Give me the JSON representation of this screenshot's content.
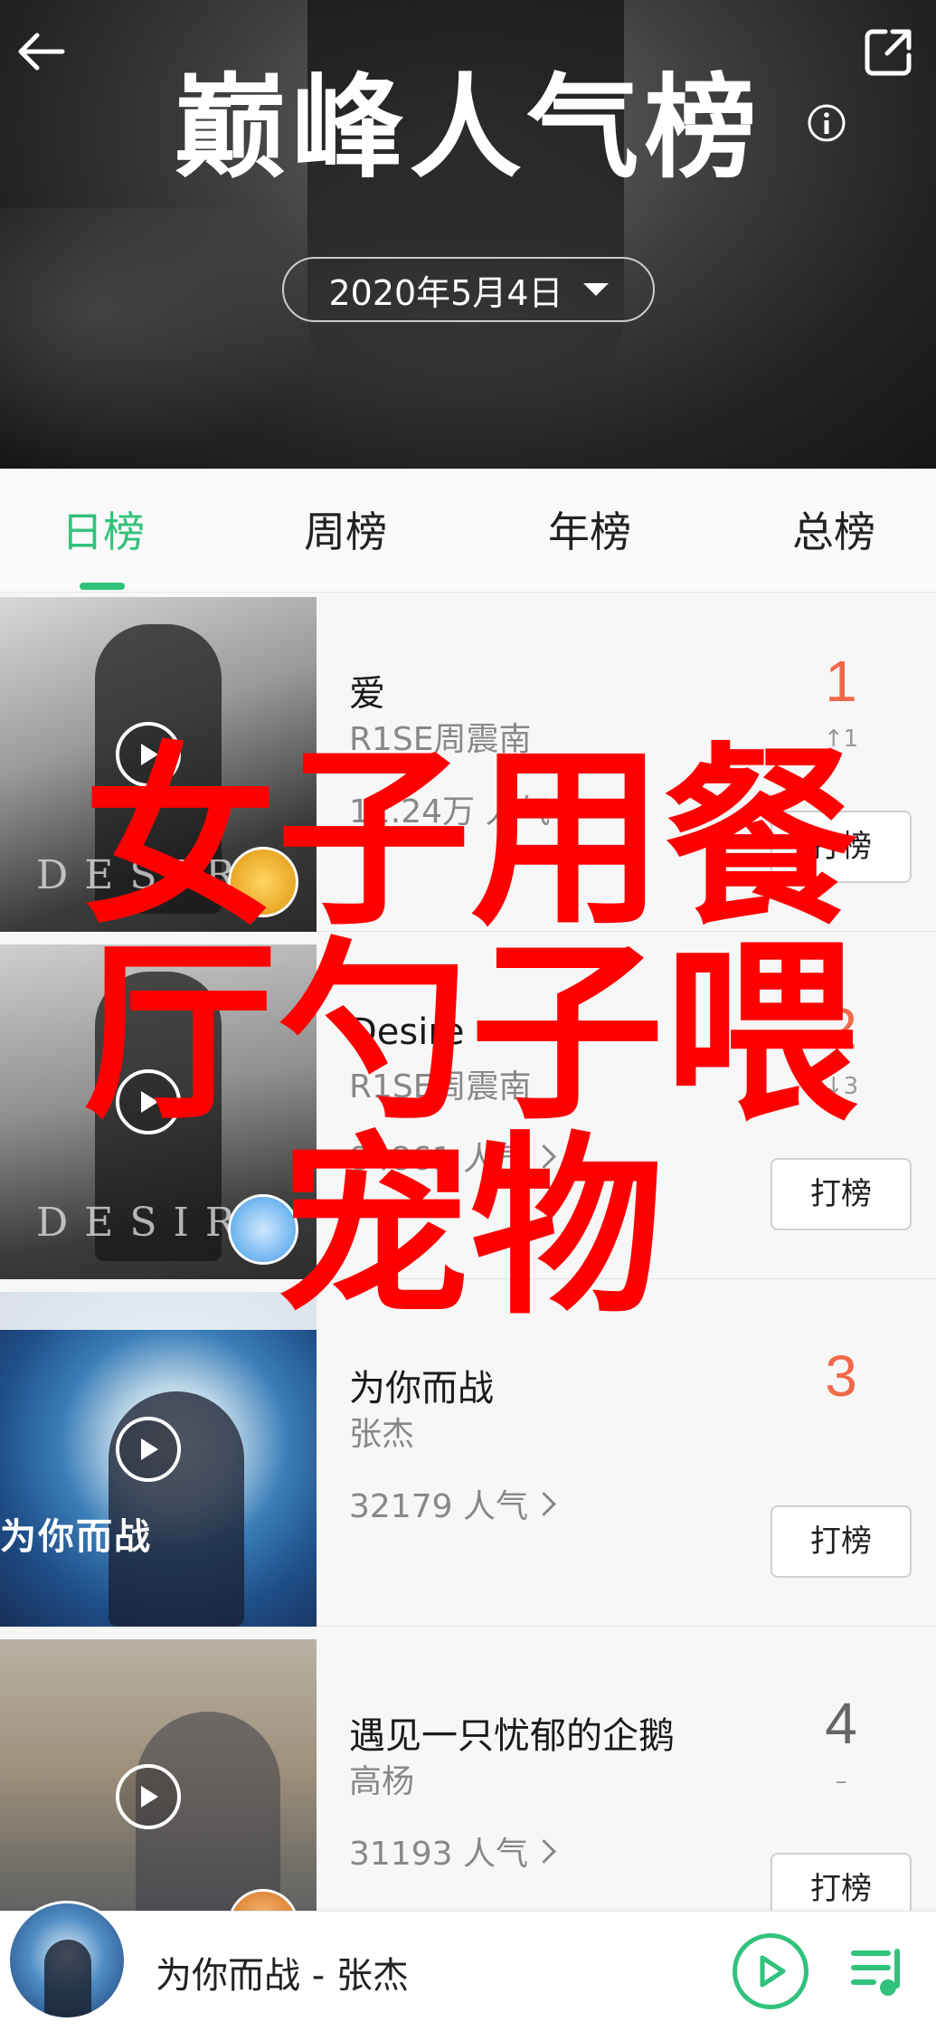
{
  "header": {
    "title": "巅峰人气榜",
    "date": "2020年5月4日"
  },
  "tabs": [
    {
      "label": "日榜",
      "active": true
    },
    {
      "label": "周榜",
      "active": false
    },
    {
      "label": "年榜",
      "active": false
    },
    {
      "label": "总榜",
      "active": false
    }
  ],
  "songs": [
    {
      "rank": "1",
      "title": "爱",
      "artist": "R1SE周震南",
      "popularity": "12.24万 人气",
      "change": "↑1",
      "cover_text": "DESIRE",
      "vote_label": "打榜"
    },
    {
      "rank": "2",
      "title": "Desire",
      "artist": "R1SE周震南",
      "popularity": "84861 人气",
      "change": "↓3",
      "cover_text": "DESIRE",
      "vote_label": "打榜"
    },
    {
      "rank": "3",
      "title": "为你而战",
      "artist": "张杰",
      "popularity": "32179 人气",
      "change": "",
      "cover_text": "为你而战",
      "vote_label": "打榜"
    },
    {
      "rank": "4",
      "title": "遇见一只忧郁的企鹅",
      "artist": "高杨",
      "popularity": "31193 人气",
      "change": "–",
      "cover_text": "",
      "vote_label": "打榜"
    }
  ],
  "overlay_text": [
    "女子用餐",
    "厅勺子喂",
    "宠物"
  ],
  "player": {
    "now_playing": "为你而战 - 张杰"
  },
  "colors": {
    "accent": "#31c27c",
    "rank_hot": "#f06a4a",
    "overlay": "#ff0000"
  }
}
